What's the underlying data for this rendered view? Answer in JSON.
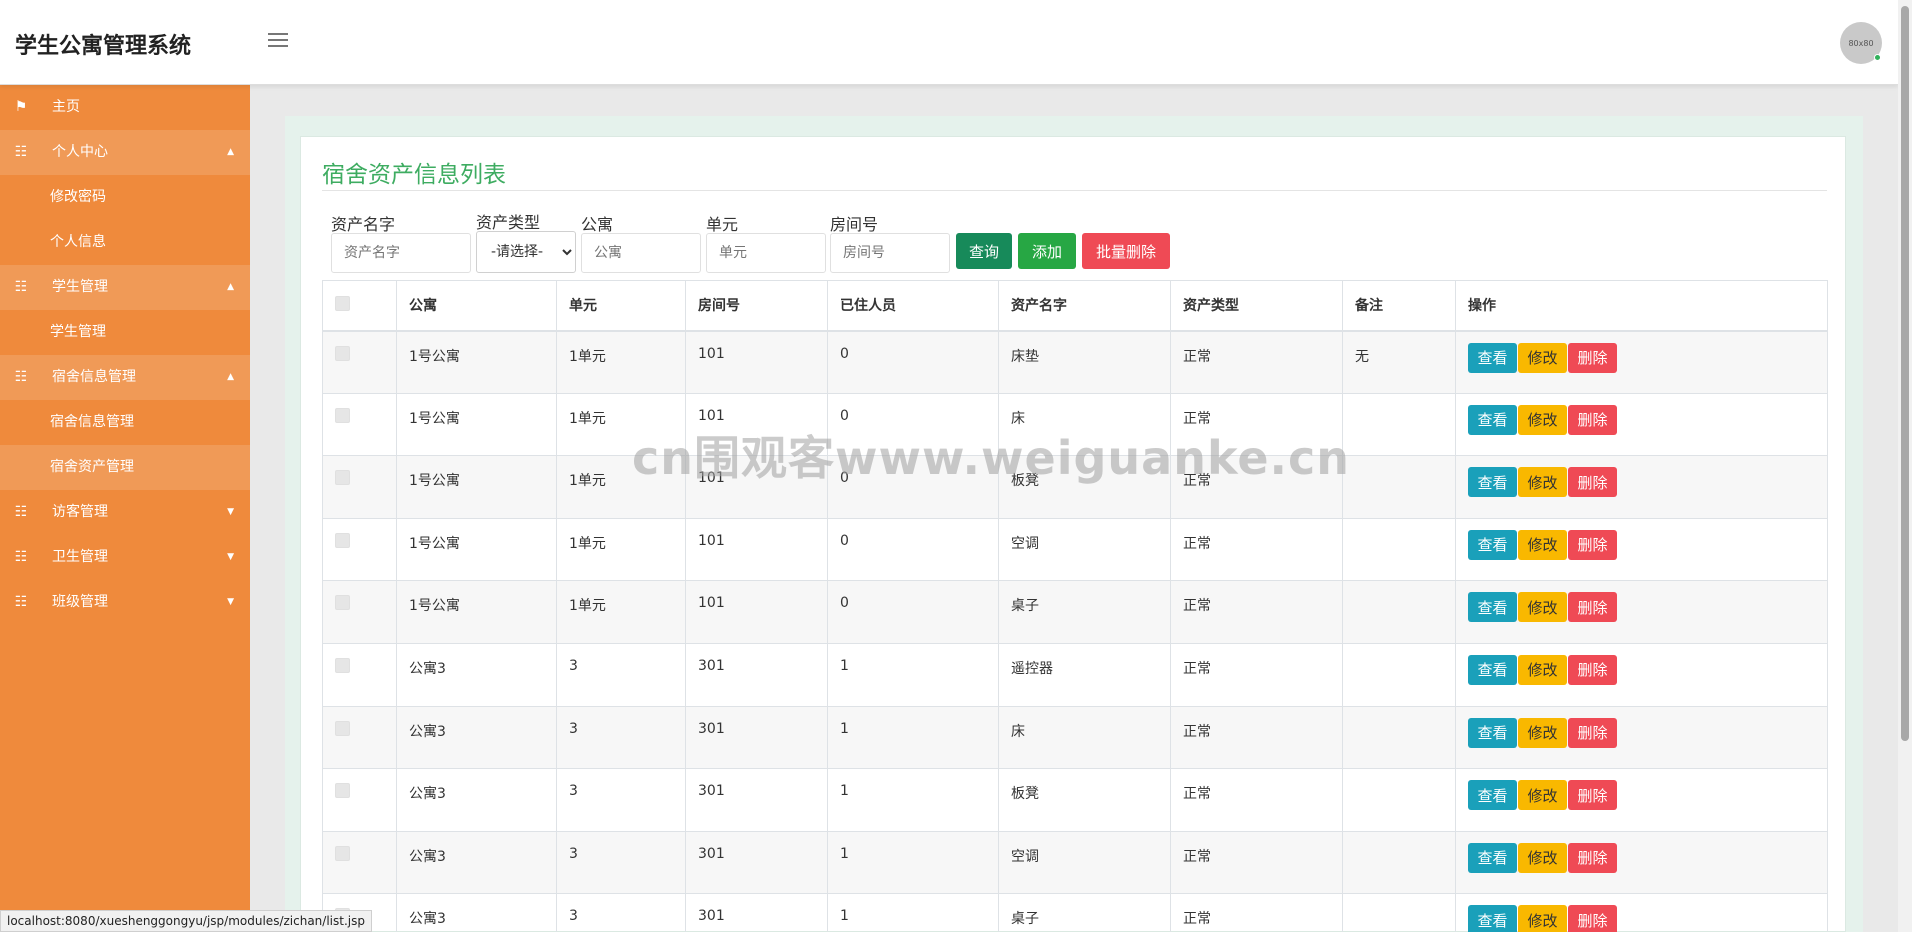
{
  "header": {
    "title": "学生公寓管理系统",
    "avatar_text": "80x80"
  },
  "sidebar": {
    "items": [
      {
        "type": "item",
        "icon": "flag-icon",
        "label": "主页"
      },
      {
        "type": "group",
        "icon": "grid-icon",
        "label": "个人中心",
        "expanded": true
      },
      {
        "type": "sub",
        "label": "修改密码"
      },
      {
        "type": "sub",
        "label": "个人信息"
      },
      {
        "type": "group",
        "icon": "grid-icon",
        "label": "学生管理",
        "expanded": true
      },
      {
        "type": "sub",
        "label": "学生管理"
      },
      {
        "type": "group",
        "icon": "grid-icon",
        "label": "宿舍信息管理",
        "expanded": true
      },
      {
        "type": "sub",
        "label": "宿舍信息管理"
      },
      {
        "type": "sub",
        "label": "宿舍资产管理",
        "active": true
      },
      {
        "type": "item",
        "icon": "grid-icon",
        "label": "访客管理",
        "expanded": false
      },
      {
        "type": "item",
        "icon": "grid-icon",
        "label": "卫生管理",
        "expanded": false
      },
      {
        "type": "item",
        "icon": "grid-icon",
        "label": "班级管理",
        "expanded": false
      }
    ]
  },
  "main": {
    "title": "宿舍资产信息列表",
    "filters": {
      "asset_name": {
        "label": "资产名字",
        "placeholder": "资产名字"
      },
      "asset_type": {
        "label": "资产类型",
        "selected": "-请选择-"
      },
      "apartment": {
        "label": "公寓",
        "placeholder": "公寓"
      },
      "unit": {
        "label": "单元",
        "placeholder": "单元"
      },
      "room": {
        "label": "房间号",
        "placeholder": "房间号"
      }
    },
    "buttons": {
      "search": "查询",
      "add": "添加",
      "batch_delete": "批量删除"
    },
    "table": {
      "headers": [
        "公寓",
        "单元",
        "房间号",
        "已住人员",
        "资产名字",
        "资产类型",
        "备注",
        "操作"
      ],
      "action_labels": {
        "view": "查看",
        "edit": "修改",
        "delete": "删除"
      },
      "rows": [
        {
          "apartment": "1号公寓",
          "unit": "1单元",
          "room": "101",
          "residents": "0",
          "asset": "床垫",
          "type": "正常",
          "remark": "无"
        },
        {
          "apartment": "1号公寓",
          "unit": "1单元",
          "room": "101",
          "residents": "0",
          "asset": "床",
          "type": "正常",
          "remark": ""
        },
        {
          "apartment": "1号公寓",
          "unit": "1单元",
          "room": "101",
          "residents": "0",
          "asset": "板凳",
          "type": "正常",
          "remark": ""
        },
        {
          "apartment": "1号公寓",
          "unit": "1单元",
          "room": "101",
          "residents": "0",
          "asset": "空调",
          "type": "正常",
          "remark": ""
        },
        {
          "apartment": "1号公寓",
          "unit": "1单元",
          "room": "101",
          "residents": "0",
          "asset": "桌子",
          "type": "正常",
          "remark": ""
        },
        {
          "apartment": "公寓3",
          "unit": "3",
          "room": "301",
          "residents": "1",
          "asset": "遥控器",
          "type": "正常",
          "remark": ""
        },
        {
          "apartment": "公寓3",
          "unit": "3",
          "room": "301",
          "residents": "1",
          "asset": "床",
          "type": "正常",
          "remark": ""
        },
        {
          "apartment": "公寓3",
          "unit": "3",
          "room": "301",
          "residents": "1",
          "asset": "板凳",
          "type": "正常",
          "remark": ""
        },
        {
          "apartment": "公寓3",
          "unit": "3",
          "room": "301",
          "residents": "1",
          "asset": "空调",
          "type": "正常",
          "remark": ""
        },
        {
          "apartment": "公寓3",
          "unit": "3",
          "room": "301",
          "residents": "1",
          "asset": "桌子",
          "type": "正常",
          "remark": ""
        }
      ]
    }
  },
  "watermark": "cn围观客www.weiguanke.cn",
  "status_url": "localhost:8080/xueshenggongyu/jsp/modules/zichan/list.jsp"
}
